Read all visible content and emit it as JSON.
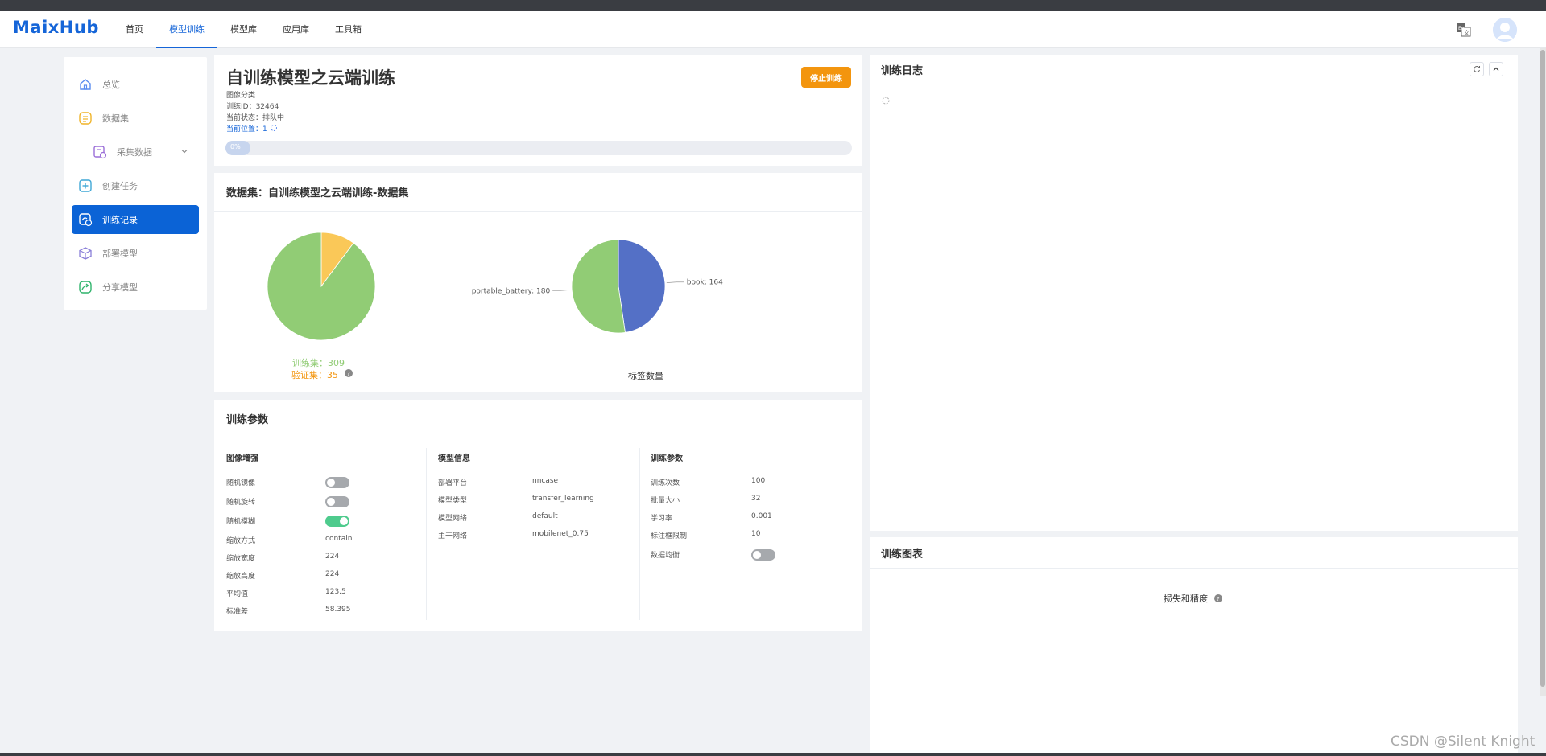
{
  "app": {
    "logo": "MaixHub",
    "watermark": "CSDN @Silent Knight"
  },
  "nav": {
    "items": [
      {
        "label": "首页",
        "active": false
      },
      {
        "label": "模型训练",
        "active": true
      },
      {
        "label": "模型库",
        "active": false
      },
      {
        "label": "应用库",
        "active": false
      },
      {
        "label": "工具箱",
        "active": false
      }
    ]
  },
  "sidebar": {
    "items": [
      {
        "label": "总览",
        "icon": "home-icon"
      },
      {
        "label": "数据集",
        "icon": "dataset-icon"
      },
      {
        "label": "采集数据",
        "icon": "collect-data-icon"
      },
      {
        "label": "创建任务",
        "icon": "create-task-icon"
      },
      {
        "label": "训练记录",
        "icon": "train-record-icon"
      },
      {
        "label": "部署模型",
        "icon": "deploy-icon"
      },
      {
        "label": "分享模型",
        "icon": "share-icon"
      }
    ]
  },
  "training": {
    "title": "自训练模型之云端训练",
    "type": "图像分类",
    "id_line": "训练ID：32464",
    "status_line": "当前状态：排队中",
    "position_line": "当前位置：1",
    "stop_label": "停止训练",
    "progress": {
      "percent": 0,
      "label": "0%"
    }
  },
  "dataset": {
    "title": "数据集：自训练模型之云端训练-数据集",
    "split_legend": {
      "train": "训练集：309",
      "val": "验证集：35"
    },
    "label_chart_caption": "标签数量"
  },
  "chart_data": [
    {
      "type": "pie",
      "labels": [
        "训练集",
        "验证集"
      ],
      "values": [
        309,
        35
      ],
      "colors": [
        "#91cc75",
        "#fac858"
      ]
    },
    {
      "type": "pie",
      "labels": [
        "book",
        "portable_battery"
      ],
      "values": [
        164,
        180
      ],
      "colors": [
        "#5470c6",
        "#91cc75"
      ],
      "data_labels": [
        "book: 164",
        "portable_battery: 180"
      ],
      "title": "标签数量"
    }
  ],
  "params": {
    "title": "训练参数",
    "augment": {
      "heading": "图像增强",
      "rows": [
        {
          "label": "随机镜像",
          "toggle": false
        },
        {
          "label": "随机旋转",
          "toggle": false
        },
        {
          "label": "随机模糊",
          "toggle": true
        },
        {
          "label": "缩放方式",
          "value": "contain"
        },
        {
          "label": "缩放宽度",
          "value": "224"
        },
        {
          "label": "缩放高度",
          "value": "224"
        },
        {
          "label": "平均值",
          "value": "123.5"
        },
        {
          "label": "标准差",
          "value": "58.395"
        }
      ]
    },
    "model": {
      "heading": "模型信息",
      "rows": [
        {
          "label": "部署平台",
          "value": "nncase"
        },
        {
          "label": "模型类型",
          "value": "transfer_learning"
        },
        {
          "label": "模型网络",
          "value": "default"
        },
        {
          "label": "主干网络",
          "value": "mobilenet_0.75"
        }
      ]
    },
    "train": {
      "heading": "训练参数",
      "rows": [
        {
          "label": "训练次数",
          "value": "100"
        },
        {
          "label": "批量大小",
          "value": "32"
        },
        {
          "label": "学习率",
          "value": "0.001"
        },
        {
          "label": "标注框限制",
          "value": "10"
        },
        {
          "label": "数据均衡",
          "toggle": false
        }
      ]
    }
  },
  "log": {
    "title": "训练日志"
  },
  "charts_panel": {
    "title": "训练图表",
    "subtitle": "损失和精度"
  },
  "colors": {
    "brand": "#1565d8",
    "stop": "#f3950e",
    "train": "#91cc75",
    "val": "#f3950e"
  }
}
